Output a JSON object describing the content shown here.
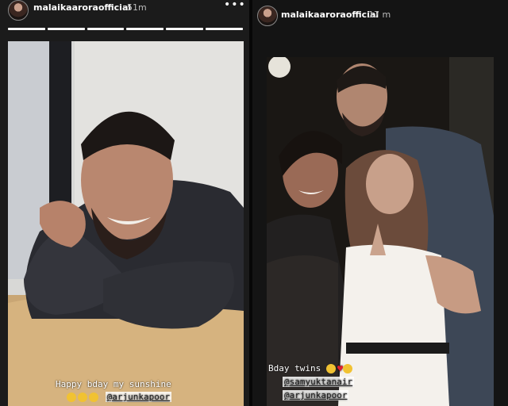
{
  "left_story": {
    "username": "malaikaaroraofficial",
    "time": "51m",
    "more_icon": "more-horizontal-icon",
    "progress_segments": 6,
    "caption_line1": "Happy bday my sunshine",
    "caption_mention": "@arjunkapoor",
    "emojis": [
      "hugging-face",
      "hugging-face",
      "hugging-face"
    ]
  },
  "right_story": {
    "username": "malaikaaroraofficial",
    "time": "17 m",
    "caption_line1": "Bday twins",
    "emojis_line1": [
      "hugging-face",
      "red-heart",
      "hugging-face"
    ],
    "mention1": "@samyuktanair",
    "mention2": "@arjunkapoor"
  },
  "colors": {
    "mention_bg": "#ffffff",
    "emoji": "#f1c232",
    "heart": "#e02030"
  }
}
